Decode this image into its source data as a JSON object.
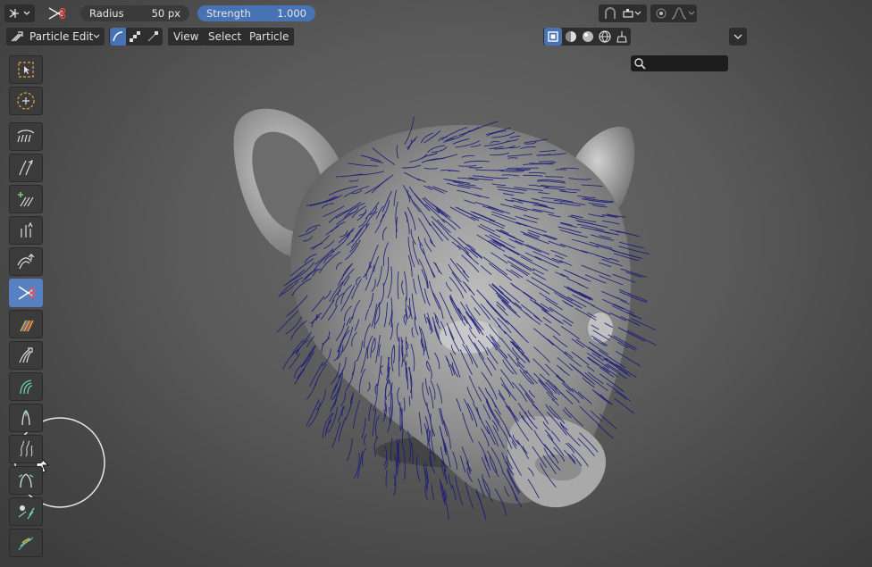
{
  "header": {
    "radius": {
      "label": "Radius",
      "value": "50 px"
    },
    "strength": {
      "label": "Strength",
      "value": "1.000"
    }
  },
  "header2": {
    "mode": "Particle Edit",
    "menu": [
      "View",
      "Select",
      "Particle"
    ],
    "search_placeholder": ""
  },
  "tools": [
    {
      "name": "select-box",
      "active": false
    },
    {
      "name": "select-circle",
      "active": false
    },
    {
      "name": "comb",
      "active": false
    },
    {
      "name": "smooth",
      "active": false
    },
    {
      "name": "add",
      "active": false
    },
    {
      "name": "length",
      "active": false
    },
    {
      "name": "puff",
      "active": false
    },
    {
      "name": "cut",
      "active": true
    },
    {
      "name": "weight",
      "active": false
    },
    {
      "name": "clump",
      "active": false
    },
    {
      "name": "part",
      "active": false
    },
    {
      "name": "curl",
      "active": false
    },
    {
      "name": "roughness",
      "active": false
    },
    {
      "name": "split",
      "active": false
    },
    {
      "name": "cut-clump",
      "active": false
    },
    {
      "name": "paint",
      "active": false
    }
  ],
  "colors": {
    "accent": "#4772b3",
    "hair": "#1a1a7a",
    "mesh": "#a8a8a8",
    "header_bg": "#2b2b2b"
  }
}
